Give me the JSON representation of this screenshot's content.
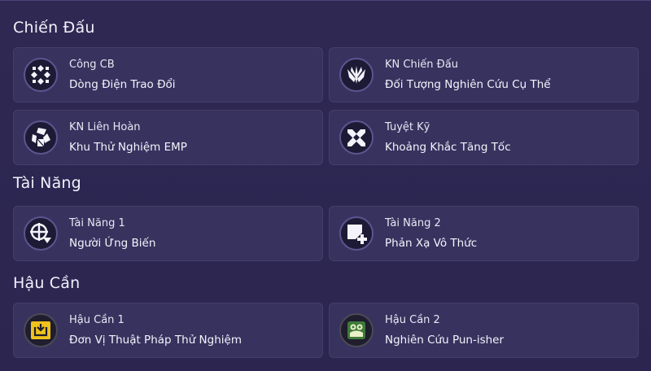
{
  "sections": [
    {
      "title": "Chiến Đấu",
      "cards": [
        {
          "label": "Công CB",
          "value": "Dòng Điện Trao Đổi",
          "icon": "basic-attack-icon"
        },
        {
          "label": "KN Chiến Đấu",
          "value": "Đối Tượng Nghiên Cứu Cụ Thể",
          "icon": "battle-skill-icon"
        },
        {
          "label": "KN Liên Hoàn",
          "value": "Khu Thử Nghiệm EMP",
          "icon": "combo-skill-icon"
        },
        {
          "label": "Tuyệt Kỹ",
          "value": "Khoảng Khắc Tăng Tốc",
          "icon": "ultimate-icon"
        }
      ]
    },
    {
      "title": "Tài Năng",
      "cards": [
        {
          "label": "Tài Năng 1",
          "value": "Người Ứng Biến",
          "icon": "talent-1-icon"
        },
        {
          "label": "Tài Năng 2",
          "value": "Phản Xạ Vô Thức",
          "icon": "talent-2-icon"
        }
      ]
    },
    {
      "title": "Hậu Cần",
      "cards": [
        {
          "label": "Hậu Cần 1",
          "value": "Đơn Vị Thuật Pháp Thử Nghiệm",
          "icon": "logistics-1-icon"
        },
        {
          "label": "Hậu Cần 2",
          "value": "Nghiên Cứu Pun-isher",
          "icon": "logistics-2-icon"
        }
      ]
    }
  ],
  "colors": {
    "background": "#2d2752",
    "card": "#38325f",
    "icon_ring": "#5b5590",
    "logistics_yellow": "#f0c21c",
    "logistics_green": "#3f7a3a"
  }
}
